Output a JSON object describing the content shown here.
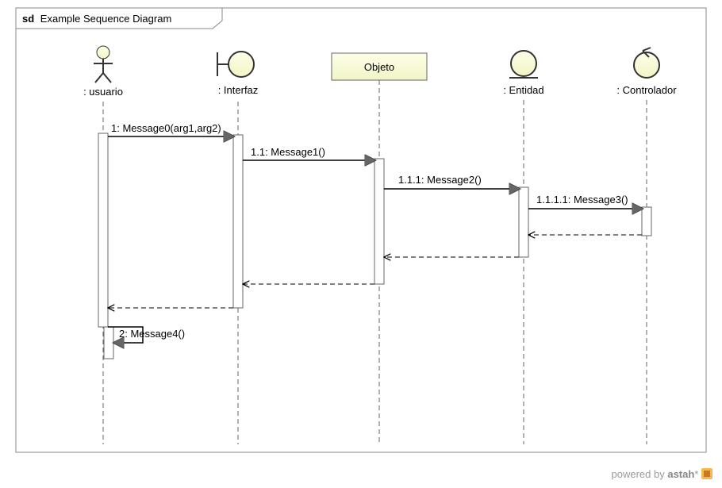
{
  "frame": {
    "prefix": "sd",
    "title": "Example Sequence Diagram"
  },
  "lifelines": {
    "usuario": {
      "label": ": usuario"
    },
    "interfaz": {
      "label": ": Interfaz"
    },
    "objeto": {
      "label": "Objeto"
    },
    "entidad": {
      "label": ": Entidad"
    },
    "controlador": {
      "label": ": Controlador"
    }
  },
  "messages": {
    "m1": {
      "label": "1: Message0(arg1,arg2)"
    },
    "m11": {
      "label": "1.1: Message1()"
    },
    "m111": {
      "label": "1.1.1: Message2()"
    },
    "m1111": {
      "label": "1.1.1.1: Message3()"
    },
    "m2": {
      "label": "2: Message4()"
    }
  },
  "footer": {
    "prefix": "powered by ",
    "brand": "astah",
    "suffix": "*"
  }
}
